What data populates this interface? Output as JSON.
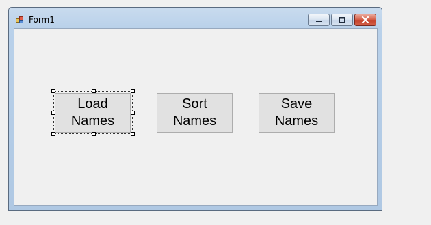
{
  "window": {
    "title": "Form1"
  },
  "buttons": {
    "load": "Load\nNames",
    "sort": "Sort\nNames",
    "save": "Save\nNames"
  },
  "icons": {
    "app": "form-app-icon",
    "minimize": "minimize-icon",
    "maximize": "maximize-icon",
    "close": "close-icon"
  },
  "colors": {
    "frame": "#b9d1ea",
    "client": "#f0f0f0",
    "button_face": "#e1e1e1",
    "close_button": "#c4412b"
  }
}
